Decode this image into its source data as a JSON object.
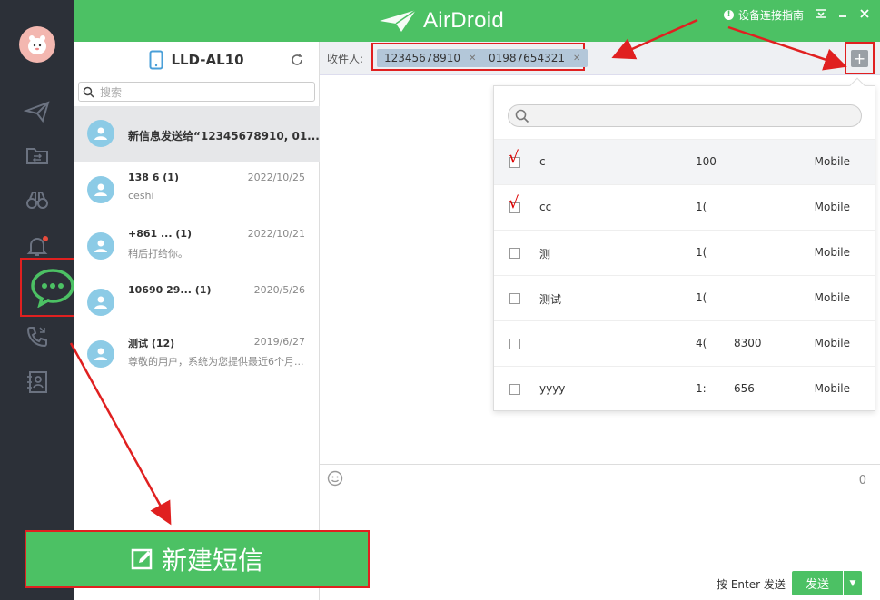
{
  "app": {
    "title": "AirDroid"
  },
  "header": {
    "guide_label": "设备连接指南"
  },
  "device": {
    "name": "LLD-AL10"
  },
  "search": {
    "placeholder": "搜索"
  },
  "conversations": [
    {
      "name": "新信息发送给“12345678910, 01...",
      "date": "",
      "preview": ""
    },
    {
      "name": "138            6  (1)",
      "date": "2022/10/25",
      "preview": "ceshi"
    },
    {
      "name": "+861          ...  (1)",
      "date": "2022/10/21",
      "preview": "稍后打给你。"
    },
    {
      "name": "10690          29...  (1)",
      "date": "2020/5/26",
      "preview": ""
    },
    {
      "name": "测试  (12)",
      "date": "2019/6/27",
      "preview": "尊敬的用户，系统为您提供最近6个月..."
    }
  ],
  "new_sms": {
    "label": "新建短信"
  },
  "recipients": {
    "label": "收件人:",
    "chips": [
      "12345678910",
      "01987654321"
    ]
  },
  "contacts": [
    {
      "checked": true,
      "name": "c",
      "number": "100",
      "number2": "",
      "type": "Mobile"
    },
    {
      "checked": true,
      "name": "cc",
      "number": "1(",
      "number2": "",
      "type": "Mobile"
    },
    {
      "checked": false,
      "name": "测",
      "number": "1(",
      "number2": "",
      "type": "Mobile"
    },
    {
      "checked": false,
      "name": "测试",
      "number": "1(",
      "number2": "",
      "type": "Mobile"
    },
    {
      "checked": false,
      "name": "",
      "number": "4(",
      "number2": "8300",
      "type": "Mobile"
    },
    {
      "checked": false,
      "name": "yyyy",
      "number": "1:",
      "number2": "656",
      "type": "Mobile"
    }
  ],
  "compose": {
    "counter": "0",
    "enter_hint": "按 Enter 发送",
    "send_label": "发送"
  },
  "colors": {
    "brand_green": "#4cc164",
    "sidebar": "#2c3038",
    "highlight": "#e02020"
  }
}
